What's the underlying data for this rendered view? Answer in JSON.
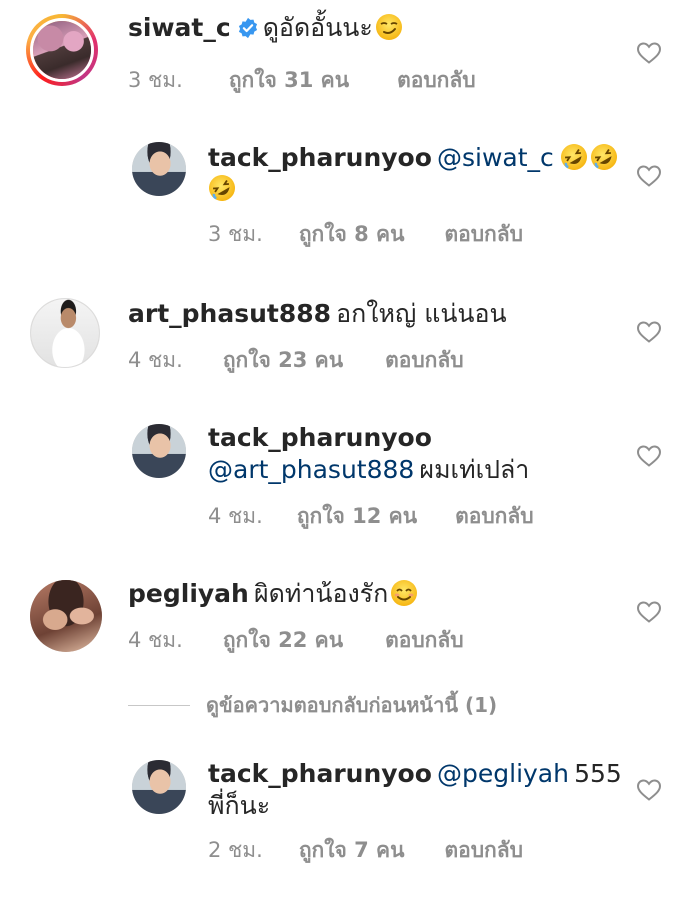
{
  "comments": [
    {
      "username": "siwat_c",
      "verified": true,
      "text": "ดูอัดอั้นนะ",
      "time": "3 ชม.",
      "likes": "ถูกใจ 31 คน",
      "reply": "ตอบกลับ"
    },
    {
      "username": "tack_pharunyoo",
      "mention": "@siwat_c",
      "time": "3 ชม.",
      "likes": "ถูกใจ 8 คน",
      "reply": "ตอบกลับ"
    },
    {
      "username": "art_phasut888",
      "text": "อกใหญ่ แน่นอน",
      "time": "4 ชม.",
      "likes": "ถูกใจ 23 คน",
      "reply": "ตอบกลับ"
    },
    {
      "username": "tack_pharunyoo",
      "mention": "@art_phasut888",
      "text": "ผมเท่เปล่า",
      "time": "4 ชม.",
      "likes": "ถูกใจ 12 คน",
      "reply": "ตอบกลับ"
    },
    {
      "username": "pegliyah",
      "text": "ผิดท่าน้องรัก",
      "time": "4 ชม.",
      "likes": "ถูกใจ 22 คน",
      "reply": "ตอบกลับ"
    },
    {
      "username": "tack_pharunyoo",
      "mention": "@pegliyah",
      "text": "555",
      "text2": "พี่ก็นะ",
      "time": "2 ชม.",
      "likes": "ถูกใจ 7 คน",
      "reply": "ตอบกลับ"
    }
  ],
  "view_previous_replies": "ดูข้อความตอบกลับก่อนหน้านี้ (1)",
  "icons": {
    "heart": "heart-outline-icon",
    "verified": "verified-badge-icon",
    "smirk": "smirking-face-emoji",
    "laugh": "rolling-on-floor-laughing-emoji",
    "smile": "smiling-face-emoji"
  },
  "colors": {
    "text": "#262626",
    "muted": "#8e8e8e",
    "mention": "#00376b",
    "verified": "#3897f0"
  }
}
